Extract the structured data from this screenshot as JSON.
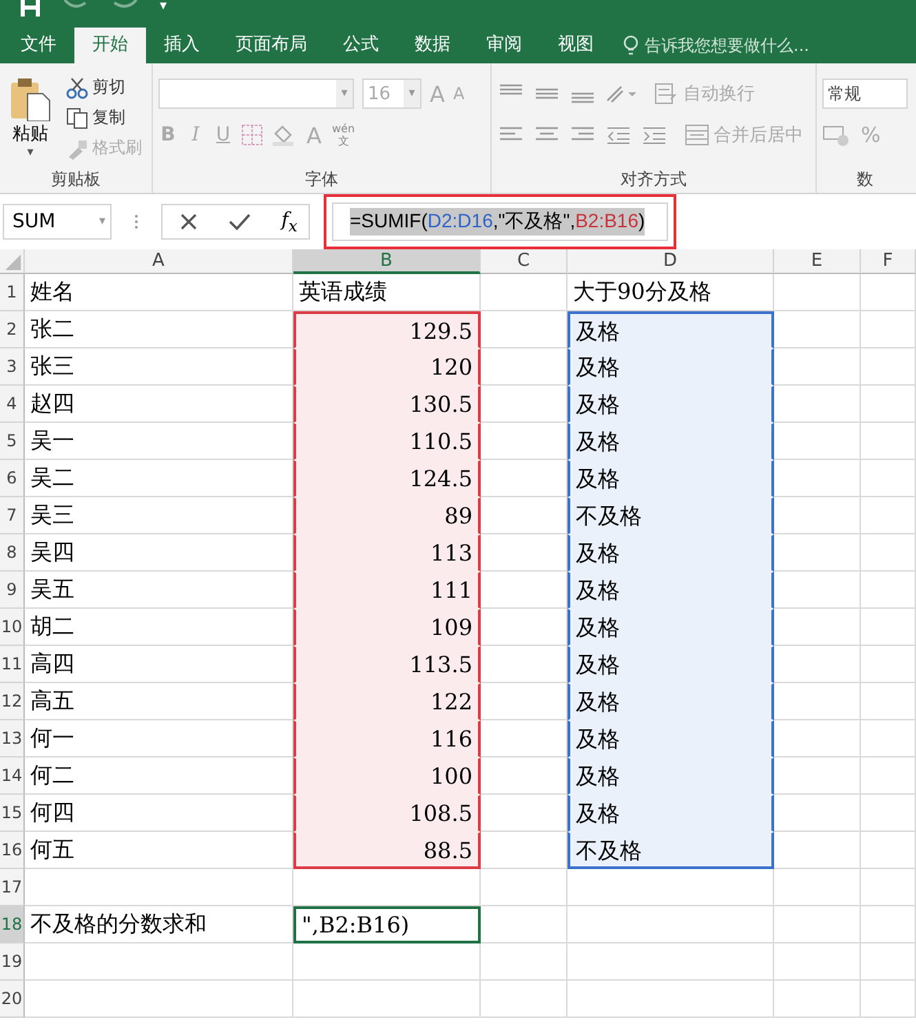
{
  "quick_access": {
    "caret": "▾"
  },
  "tabs": [
    {
      "label": "文件",
      "selected": false
    },
    {
      "label": "开始",
      "selected": true
    },
    {
      "label": "插入",
      "selected": false
    },
    {
      "label": "页面布局",
      "selected": false
    },
    {
      "label": "公式",
      "selected": false
    },
    {
      "label": "数据",
      "selected": false
    },
    {
      "label": "审阅",
      "selected": false
    },
    {
      "label": "视图",
      "selected": false
    }
  ],
  "tell_me": {
    "placeholder": "告诉我您想要做什么..."
  },
  "ribbon": {
    "clipboard": {
      "paste": "粘贴",
      "cut": "剪切",
      "copy": "复制",
      "painter": "格式刷",
      "label": "剪贴板"
    },
    "font": {
      "font_size": "16",
      "bold": "B",
      "italic": "I",
      "underline": "U",
      "font_color": "A",
      "grow": "A",
      "shrink": "A",
      "phonetic_top": "wén",
      "phonetic_bottom": "文",
      "label": "字体"
    },
    "alignment": {
      "wrap": "自动换行",
      "merge": "合并后居中",
      "label": "对齐方式"
    },
    "number": {
      "format": "常规",
      "percent": "%",
      "label": "数"
    }
  },
  "formula_bar": {
    "name_box": "SUM",
    "function_label": "f$_{x}$",
    "outlined": true,
    "formula": [
      {
        "text": "=SUMIF(",
        "color": "#000000"
      },
      {
        "text": "D2:D16",
        "color": "#2e64c8"
      },
      {
        "text": ",\"不及格\",",
        "color": "#000000"
      },
      {
        "text": "B2:B16",
        "color": "#c8323c"
      },
      {
        "text": ")",
        "color": "#000000"
      }
    ]
  },
  "columns": [
    {
      "label": "A",
      "selected": false,
      "numeric": false
    },
    {
      "label": "B",
      "selected": true,
      "numeric": true,
      "color": "#dc3c46"
    },
    {
      "label": "C",
      "selected": false,
      "numeric": false
    },
    {
      "label": "D",
      "selected": false,
      "numeric": false,
      "color": "#3a72cc"
    },
    {
      "label": "E",
      "selected": false,
      "numeric": false
    },
    {
      "label": "F",
      "selected": false,
      "numeric": false
    }
  ],
  "rows": [
    {
      "number": "1",
      "kind": "header",
      "referenced": false,
      "editing": false,
      "cells": [
        "姓名",
        "英语成绩",
        "",
        "大于90分及格"
      ]
    },
    {
      "number": "2",
      "kind": "data",
      "referenced": true,
      "editing": false,
      "cells": [
        "张二",
        "129.5",
        "",
        "及格"
      ]
    },
    {
      "number": "3",
      "kind": "data",
      "referenced": true,
      "editing": false,
      "cells": [
        "张三",
        "120",
        "",
        "及格"
      ]
    },
    {
      "number": "4",
      "kind": "data",
      "referenced": true,
      "editing": false,
      "cells": [
        "赵四",
        "130.5",
        "",
        "及格"
      ]
    },
    {
      "number": "5",
      "kind": "data",
      "referenced": true,
      "editing": false,
      "cells": [
        "吴一",
        "110.5",
        "",
        "及格"
      ]
    },
    {
      "number": "6",
      "kind": "data",
      "referenced": true,
      "editing": false,
      "cells": [
        "吴二",
        "124.5",
        "",
        "及格"
      ]
    },
    {
      "number": "7",
      "kind": "data",
      "referenced": true,
      "editing": false,
      "cells": [
        "吴三",
        "89",
        "",
        "不及格"
      ]
    },
    {
      "number": "8",
      "kind": "data",
      "referenced": true,
      "editing": false,
      "cells": [
        "吴四",
        "113",
        "",
        "及格"
      ]
    },
    {
      "number": "9",
      "kind": "data",
      "referenced": true,
      "editing": false,
      "cells": [
        "吴五",
        "111",
        "",
        "及格"
      ]
    },
    {
      "number": "10",
      "kind": "data",
      "referenced": true,
      "editing": false,
      "cells": [
        "胡二",
        "109",
        "",
        "及格"
      ]
    },
    {
      "number": "11",
      "kind": "data",
      "referenced": true,
      "editing": false,
      "cells": [
        "高四",
        "113.5",
        "",
        "及格"
      ]
    },
    {
      "number": "12",
      "kind": "data",
      "referenced": true,
      "editing": false,
      "cells": [
        "高五",
        "122",
        "",
        "及格"
      ]
    },
    {
      "number": "13",
      "kind": "data",
      "referenced": true,
      "editing": false,
      "cells": [
        "何一",
        "116",
        "",
        "及格"
      ]
    },
    {
      "number": "14",
      "kind": "data",
      "referenced": true,
      "editing": false,
      "cells": [
        "何二",
        "100",
        "",
        "及格"
      ]
    },
    {
      "number": "15",
      "kind": "data",
      "referenced": true,
      "editing": false,
      "cells": [
        "何四",
        "108.5",
        "",
        "及格"
      ]
    },
    {
      "number": "16",
      "kind": "data",
      "referenced": true,
      "editing": false,
      "cells": [
        "何五",
        "88.5",
        "",
        "不及格"
      ]
    },
    {
      "number": "17",
      "kind": "data",
      "referenced": false,
      "editing": false,
      "cells": []
    },
    {
      "number": "18",
      "kind": "header",
      "referenced": false,
      "editing": true,
      "cells": [
        "不及格的分数求和",
        "\",B2:B16)"
      ]
    },
    {
      "number": "19",
      "kind": "data",
      "referenced": false,
      "editing": false,
      "cells": []
    },
    {
      "number": "20",
      "kind": "data",
      "referenced": false,
      "editing": false,
      "cells": []
    }
  ]
}
